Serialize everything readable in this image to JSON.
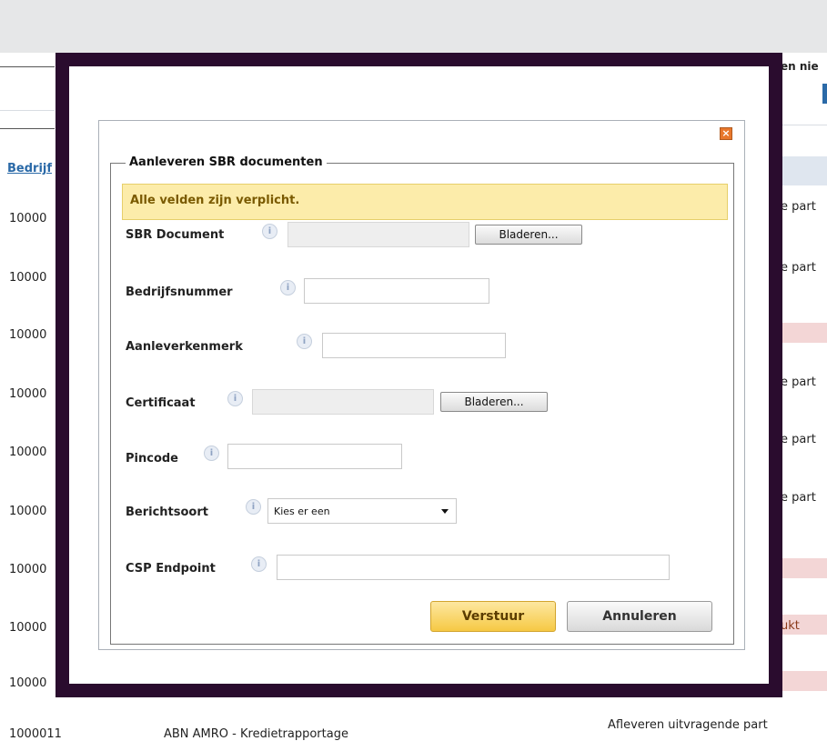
{
  "background": {
    "header_link": "Bedrijf",
    "top_right_text": "en nie",
    "row_ids": [
      "10000",
      "10000",
      "10000",
      "10000",
      "10000",
      "10000",
      "10000",
      "10000",
      "10000"
    ],
    "right_texts": [
      "e part",
      "e part",
      "",
      "e part",
      "e part",
      "e part",
      "",
      "ukt",
      ""
    ],
    "bottom_id": "1000011",
    "bottom_mid": "ABN AMRO - Kredietrapportage",
    "bottom_right": "Afleveren uitvragende part"
  },
  "dialog": {
    "close_label": "×",
    "legend": "Aanleveren SBR documenten",
    "notice": "Alle velden zijn verplicht.",
    "info_glyph": "i",
    "fields": {
      "sbr_document": {
        "label": "SBR Document",
        "browse": "Bladeren..."
      },
      "bedrijfsnummer": {
        "label": "Bedrijfsnummer",
        "value": ""
      },
      "aanleverkenmerk": {
        "label": "Aanleverkenmerk",
        "value": ""
      },
      "certificaat": {
        "label": "Certificaat",
        "browse": "Bladeren..."
      },
      "pincode": {
        "label": "Pincode",
        "value": ""
      },
      "berichtsoort": {
        "label": "Berichtsoort",
        "selected": "Kies er een"
      },
      "csp_endpoint": {
        "label": "CSP Endpoint",
        "value": ""
      }
    },
    "submit_label": "Verstuur",
    "cancel_label": "Annuleren"
  },
  "colors": {
    "overlay_border": "#2a0c2e",
    "notice_bg": "#fcecaa",
    "primary_button": "#f6c944"
  }
}
